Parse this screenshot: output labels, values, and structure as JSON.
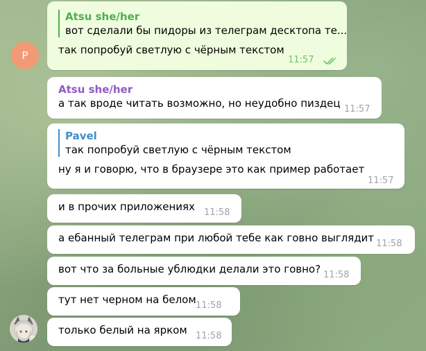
{
  "colors": {
    "outgoing_bubble": "#effdde",
    "incoming_bubble": "#ffffff",
    "reply_green": "#4fae4e",
    "reply_purple": "#8e5cc3",
    "reply_blue": "#3d8fcc",
    "avatar_orange": "#f29a76",
    "read_check": "#6dc26f"
  },
  "avatars": {
    "pavel_letter": "P",
    "atsu_image": "anime-character-avatar"
  },
  "messages": [
    {
      "reply_name": "Atsu she/her",
      "reply_text": "вот сделали бы пидоры из телеграм десктопа те...",
      "text": "так попробуй светлую с чёрным текстом",
      "time": "11:57",
      "status_icon": "double-check-icon"
    },
    {
      "sender": "Atsu she/her",
      "text": "а так вроде читать возможно, но неудобно пиздец",
      "time": "11:57"
    },
    {
      "reply_name": "Pavel",
      "reply_text": "так попробуй светлую с чёрным текстом",
      "text": "ну я и говорю, что в браузере это как пример работает",
      "time": "11:57"
    },
    {
      "text": "и в прочих приложениях",
      "time": "11:58"
    },
    {
      "text": "а ебанный телеграм при любой тебе как говно выглядит",
      "time": "11:58"
    },
    {
      "text": "вот что за больные ублюдки делали это говно?",
      "time": "11:58"
    },
    {
      "text": "тут нет черном на белом",
      "time": "11:58"
    },
    {
      "text": "только белый на ярком",
      "time": "11:58"
    }
  ]
}
